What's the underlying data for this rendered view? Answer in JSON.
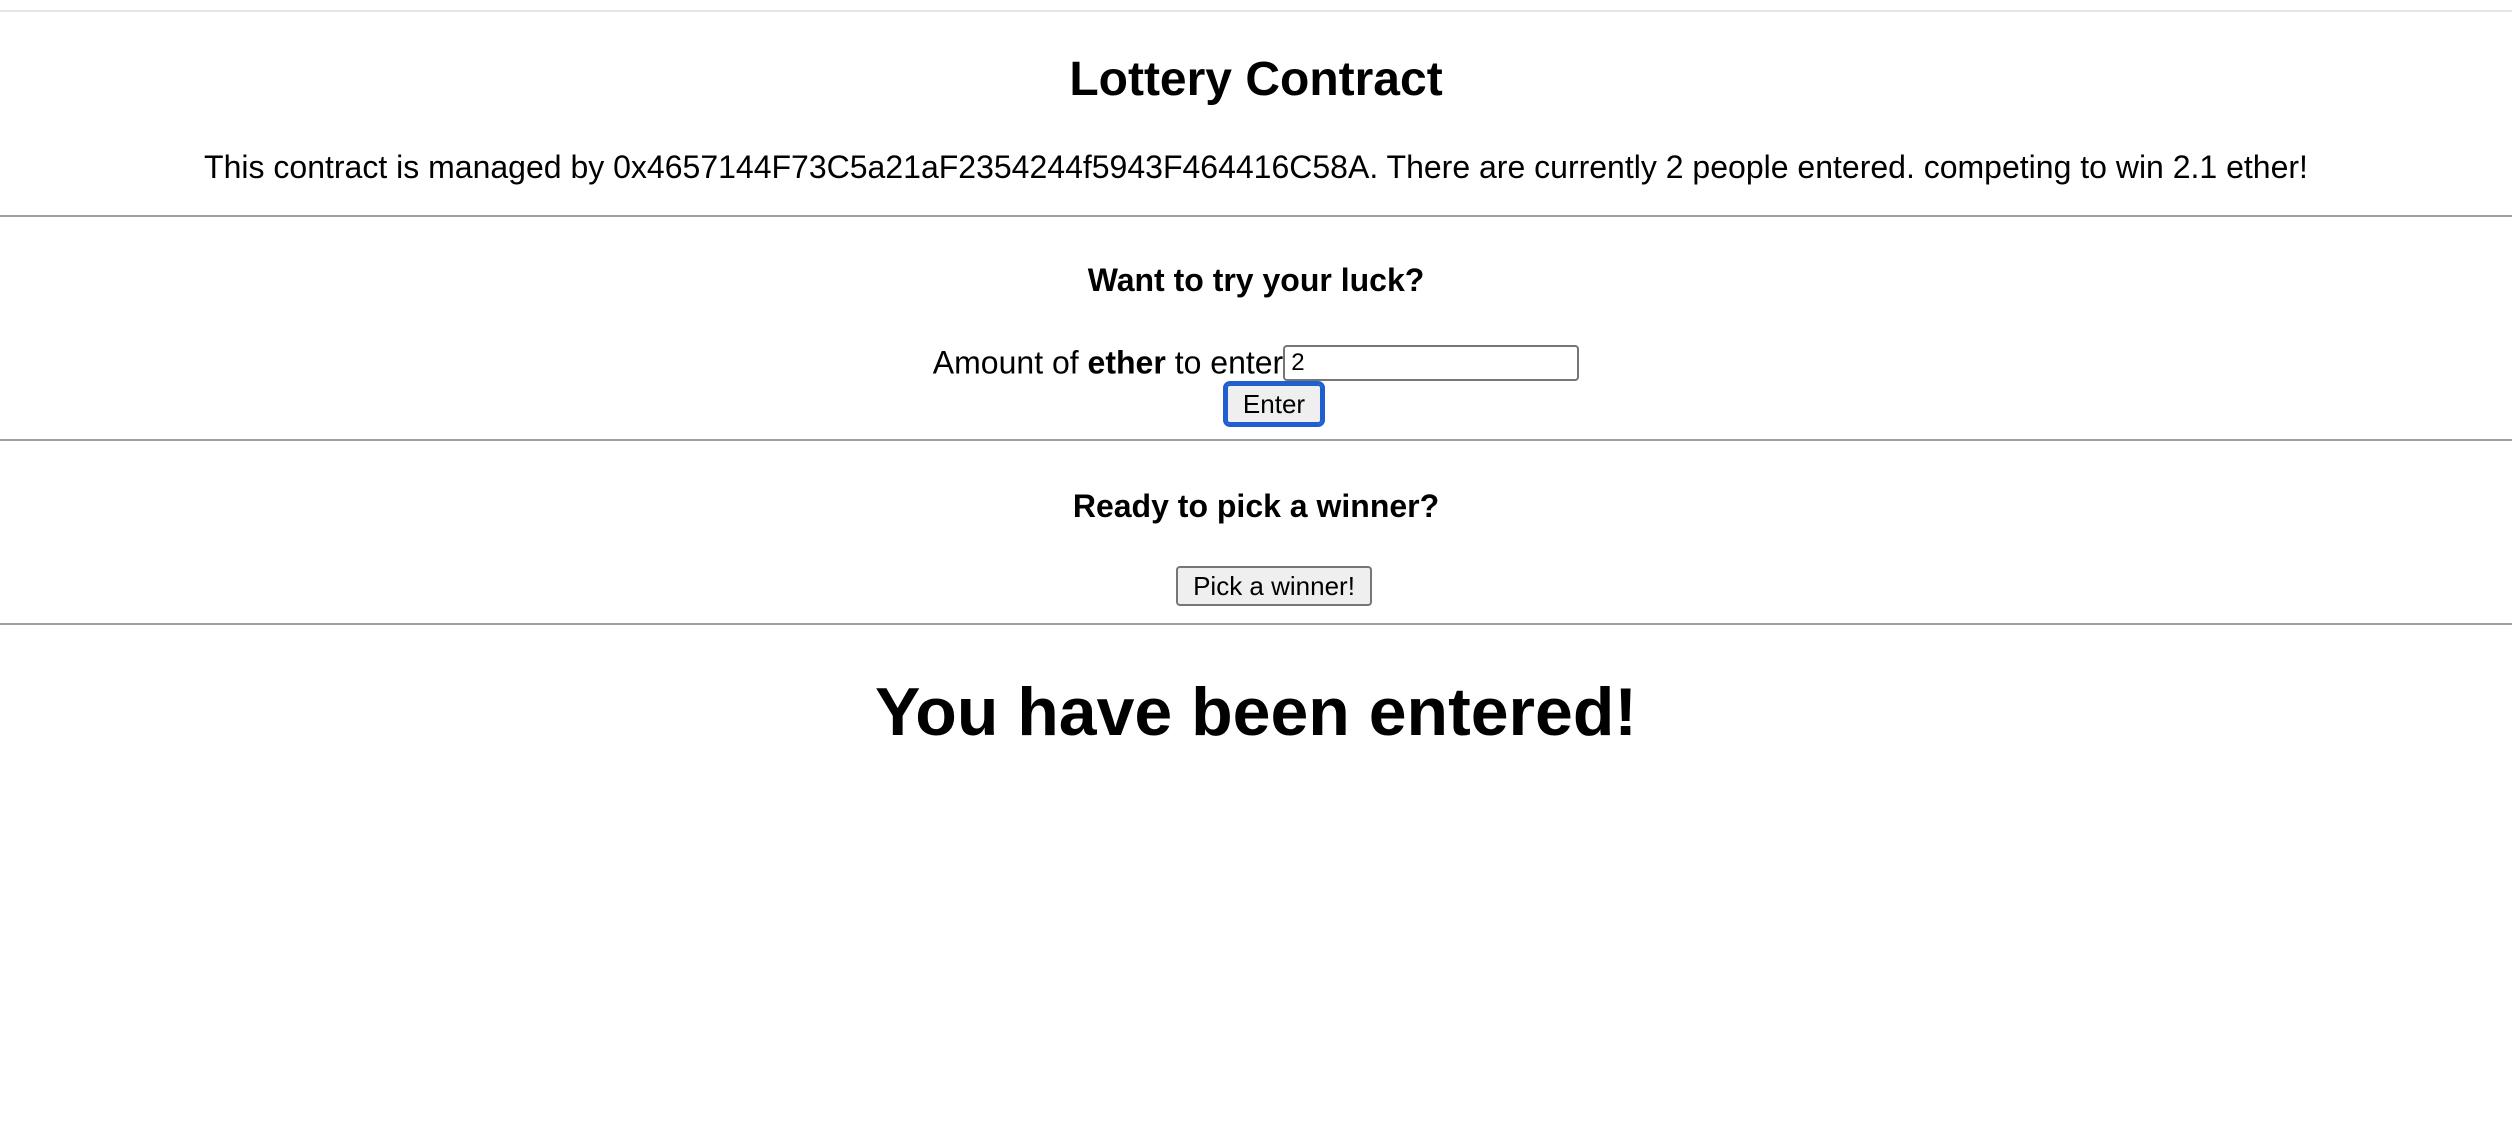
{
  "header": {
    "title": "Lottery Contract",
    "manager_text": "This contract is managed by 0x4657144F73C5a21aF2354244f5943F464416C58A. There are currently 2 people entered. competing to win 2.1 ether!"
  },
  "enter_section": {
    "heading": "Want to try your luck?",
    "label_prefix": "Amount of ",
    "label_bold": "ether",
    "label_suffix": " to enter",
    "amount_value": "2",
    "enter_label": "Enter"
  },
  "winner_section": {
    "heading": "Ready to pick a winner?",
    "pick_label": "Pick a winner!"
  },
  "status": {
    "message": "You have been entered!"
  },
  "colors": {
    "focus_ring": "#1f5fcf",
    "divider": "#9e9e9e",
    "button_bg": "#efefef"
  }
}
